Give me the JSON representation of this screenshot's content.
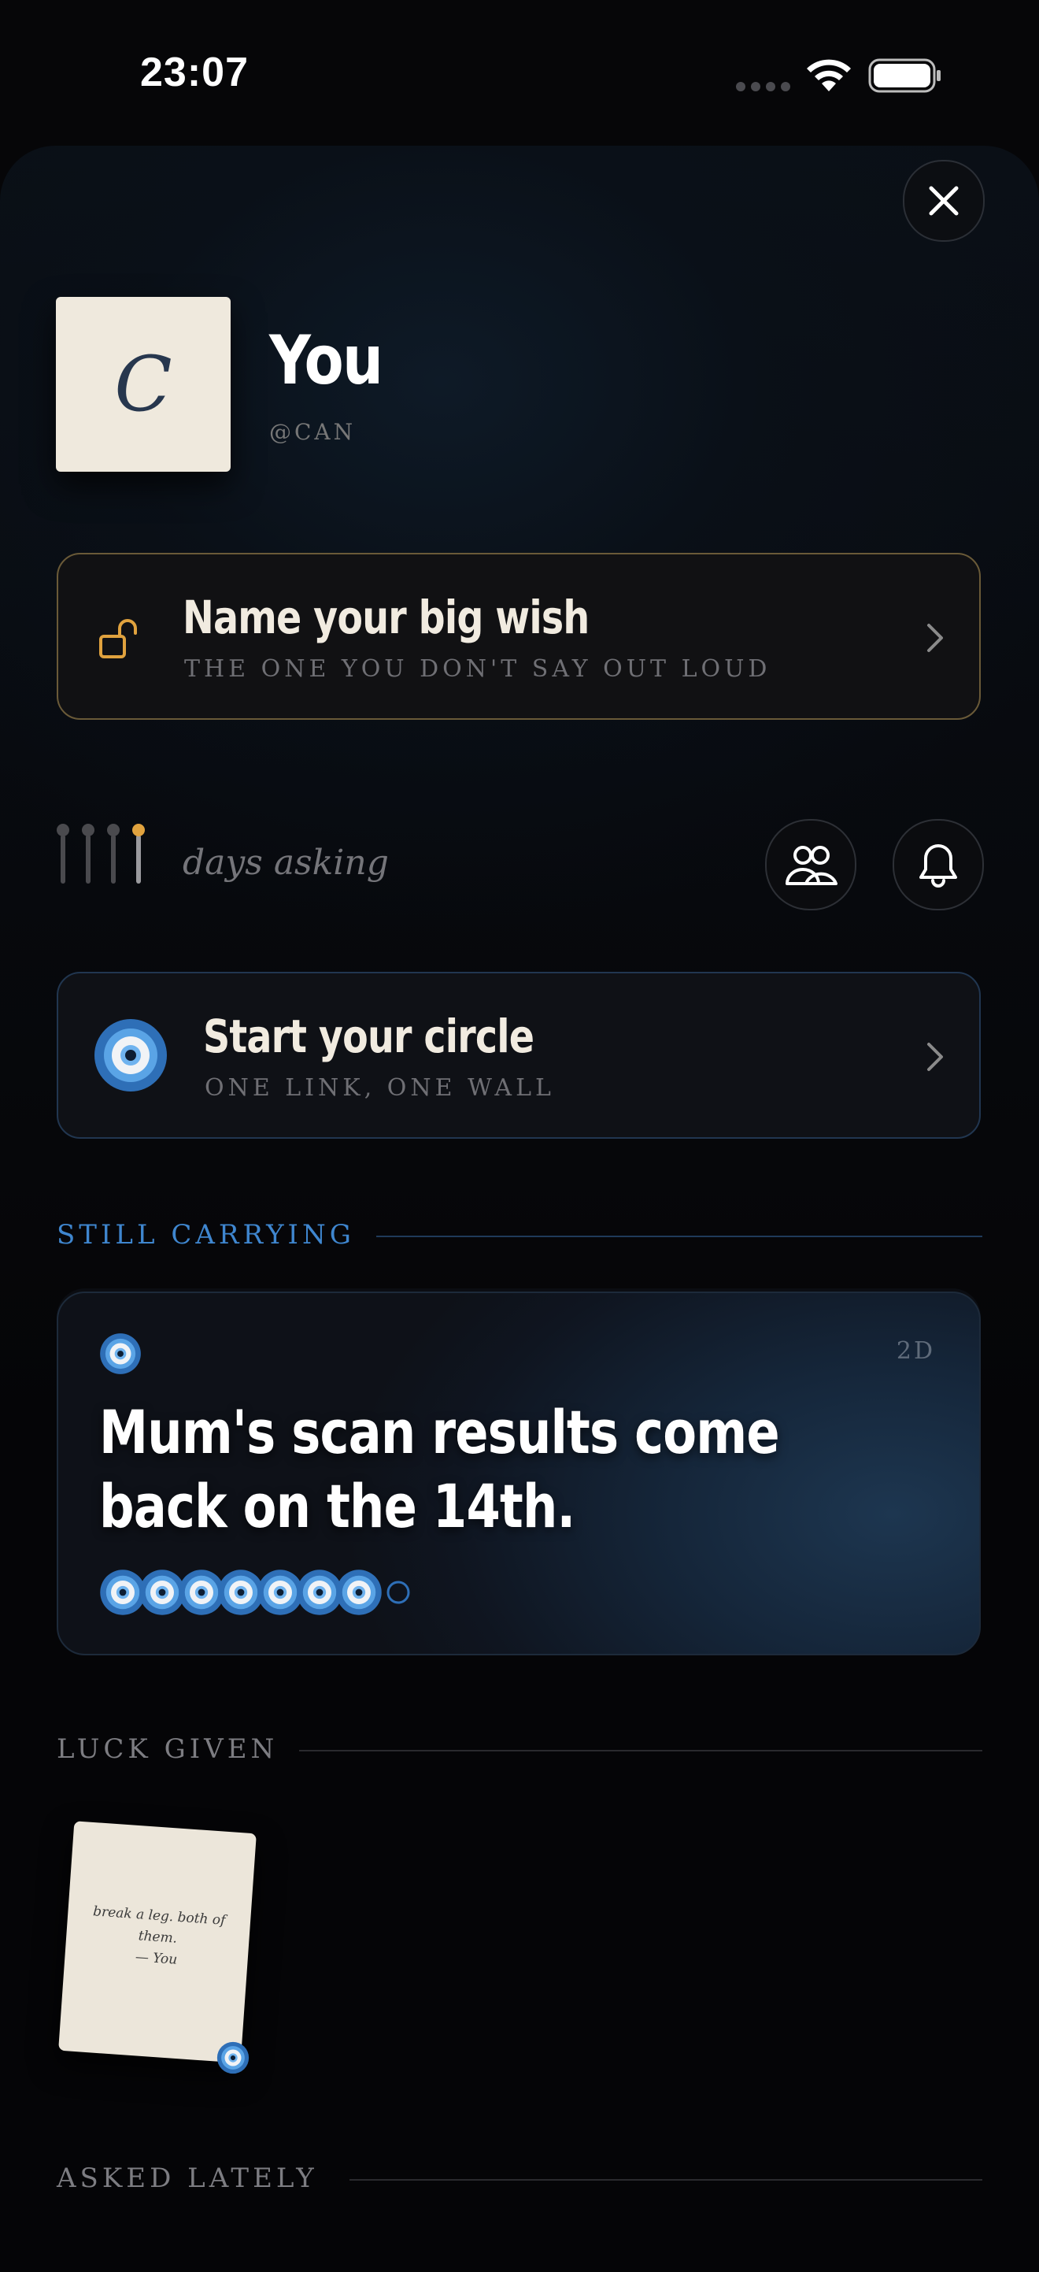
{
  "status_bar": {
    "time": "23:07"
  },
  "profile": {
    "initial": "C",
    "name": "You",
    "handle": "@CAN"
  },
  "wish_card": {
    "title": "Name your big wish",
    "subtitle": "THE ONE YOU DON'T SAY OUT LOUD"
  },
  "days": {
    "label": "days asking",
    "level": 4,
    "max": 4
  },
  "circle_card": {
    "title": "Start your circle",
    "subtitle": "ONE LINK, ONE WALL"
  },
  "still_carrying": {
    "label": "STILL CARRYING",
    "post": {
      "time": "2D",
      "text": "Mum's scan results come back on the 14th.",
      "eyes_filled": 7,
      "eyes_total": 8
    }
  },
  "luck_given": {
    "label": "LUCK GIVEN",
    "note": {
      "text": "break a leg. both of them.",
      "author": "— You"
    }
  },
  "asked_lately": {
    "label": "ASKED LATELY"
  },
  "colors": {
    "accent_blue": "#3f86cf",
    "accent_gold": "#e0a23e",
    "wish_border": "#6a5a38",
    "background": "#060608"
  },
  "icons": {
    "close": "close-icon",
    "lock": "unlocked-lock-icon",
    "chevron": "chevron-right-icon",
    "people": "people-icon",
    "bell": "bell-icon",
    "evil_eye": "evil-eye-icon"
  }
}
